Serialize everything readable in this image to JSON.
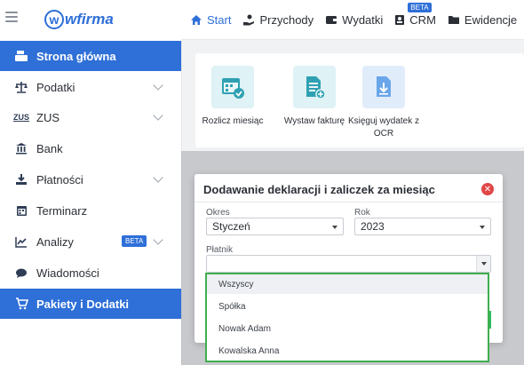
{
  "app": {
    "logo_text": "wfirma",
    "brand_color": "#2e6fd8"
  },
  "topnav": [
    {
      "label": "Start",
      "icon": "home-icon",
      "active": true
    },
    {
      "label": "Przychody",
      "icon": "hand-coins-icon"
    },
    {
      "label": "Wydatki",
      "icon": "wallet-icon"
    },
    {
      "label": "CRM",
      "icon": "contact-card-icon",
      "badge": "BETA"
    },
    {
      "label": "Ewidencje",
      "icon": "folder-icon"
    }
  ],
  "sidebar": [
    {
      "label": "Strona główna",
      "icon": "cash-register-icon",
      "active": true
    },
    {
      "label": "Podatki",
      "icon": "scales-icon",
      "chevron": true
    },
    {
      "label": "ZUS",
      "icon": "zus-logo-icon",
      "chevron": true
    },
    {
      "label": "Bank",
      "icon": "bank-icon"
    },
    {
      "label": "Płatności",
      "icon": "download-icon",
      "chevron": true
    },
    {
      "label": "Terminarz",
      "icon": "calendar-icon"
    },
    {
      "label": "Analizy",
      "icon": "line-chart-icon",
      "chevron": true,
      "badge": "BETA"
    },
    {
      "label": "Wiadomości",
      "icon": "speech-bubble-icon"
    },
    {
      "label": "Pakiety i Dodatki",
      "icon": "cart-icon",
      "highlighted": true
    }
  ],
  "quick_actions": [
    {
      "label": "Rozlicz miesiąc",
      "icon": "calendar-check-icon"
    },
    {
      "label": "Wystaw fakturę",
      "icon": "invoice-add-icon"
    },
    {
      "label": "Księguj wydatek z OCR",
      "icon": "document-upload-icon"
    }
  ],
  "modal": {
    "title": "Dodawanie deklaracji i zaliczek za miesiąc",
    "okres_label": "Okres",
    "okres_value": "Styczeń",
    "rok_label": "Rok",
    "rok_value": "2023",
    "platnik_label": "Płatnik",
    "platnik_value": ""
  },
  "dropdown": {
    "options": [
      "Wszyscy",
      "Spółka",
      "Nowak Adam",
      "Kowalska Anna"
    ],
    "highlighted_index": 0,
    "border_color": "#3fae4f"
  }
}
